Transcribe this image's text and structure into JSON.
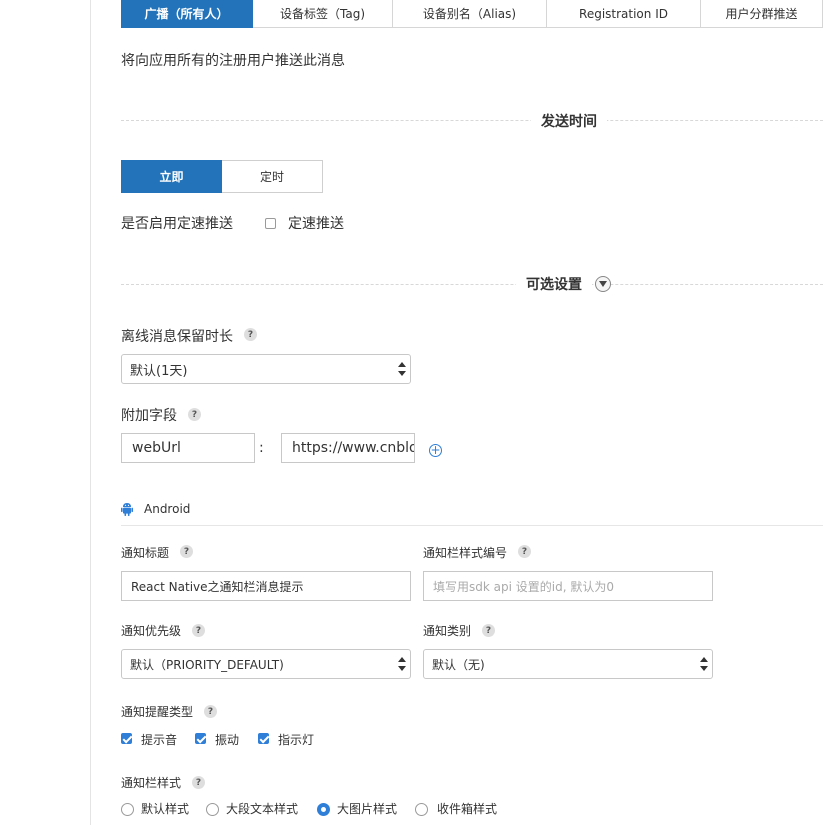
{
  "tabs": [
    {
      "label": "广播（所有人）",
      "active": true
    },
    {
      "label": "设备标签（Tag)",
      "active": false
    },
    {
      "label": "设备别名（Alias)",
      "active": false
    },
    {
      "label": "Registration ID",
      "active": false
    },
    {
      "label": "用户分群推送",
      "active": false
    }
  ],
  "broadcast_note": "将向应用所有的注册用户推送此消息",
  "send_time": {
    "heading": "发送时间",
    "options": [
      {
        "label": "立即",
        "selected": true
      },
      {
        "label": "定时",
        "selected": false
      }
    ],
    "rate_limit_question": "是否启用定速推送",
    "rate_limit_checkbox_label": "定速推送",
    "rate_limit_checked": false
  },
  "optional": {
    "heading": "可选设置",
    "offline_label": "离线消息保留时长",
    "offline_value": "默认(1天)",
    "extra_label": "附加字段",
    "extra_key": "webUrl",
    "extra_separator": ":",
    "extra_value": "https://www.cnblog"
  },
  "android": {
    "platform_label": "Android",
    "title_label": "通知标题",
    "title_value": "React Native之通知栏消息提示",
    "style_id_label": "通知栏样式编号",
    "style_id_placeholder": "填写用sdk api 设置的id, 默认为0",
    "priority_label": "通知优先级",
    "priority_value": "默认（PRIORITY_DEFAULT)",
    "category_label": "通知类别",
    "category_value": "默认（无)",
    "alert_type_label": "通知提醒类型",
    "alert_types": [
      {
        "label": "提示音",
        "checked": true
      },
      {
        "label": "振动",
        "checked": true
      },
      {
        "label": "指示灯",
        "checked": true
      }
    ],
    "bar_style_label": "通知栏样式",
    "bar_styles": [
      {
        "label": "默认样式",
        "checked": false
      },
      {
        "label": "大段文本样式",
        "checked": false
      },
      {
        "label": "大图片样式",
        "checked": true
      },
      {
        "label": "收件箱样式",
        "checked": false
      }
    ]
  },
  "help_glyph": "?",
  "colors": {
    "accent": "#2273b9",
    "check": "#2f7fd8",
    "android": "#2f7fd8"
  }
}
